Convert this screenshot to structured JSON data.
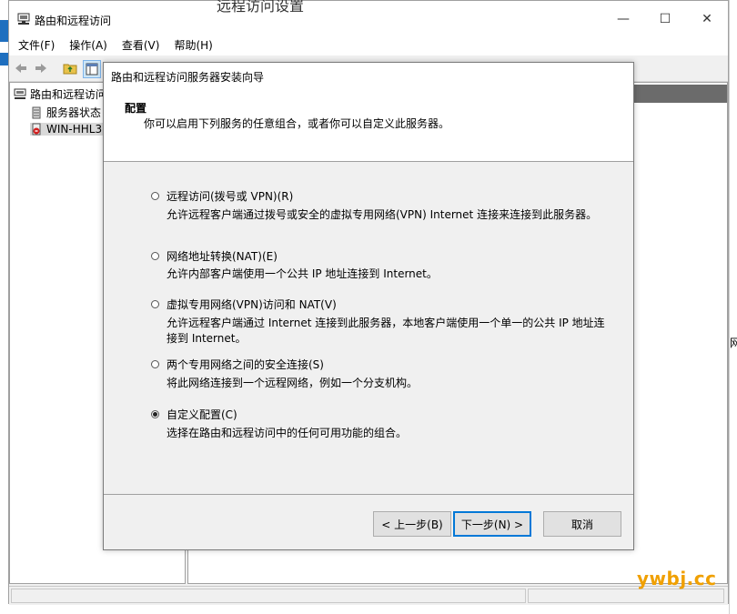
{
  "main_window": {
    "title": "路由和远程访问",
    "controls": {
      "minimize": "—",
      "maximize": "☐",
      "close": "✕"
    },
    "menu": [
      "文件(F)",
      "操作(A)",
      "查看(V)",
      "帮助(H)"
    ],
    "tree": {
      "root": "路由和远程访问",
      "items": [
        "服务器状态",
        "WIN-HHL3"
      ]
    }
  },
  "wizard": {
    "title": "路由和远程访问服务器安装向导",
    "header_title": "配置",
    "header_subtitle": "你可以启用下列服务的任意组合，或者你可以自定义此服务器。",
    "options": [
      {
        "label": "远程访问(拨号或 VPN)(R)",
        "desc": "允许远程客户端通过拨号或安全的虚拟专用网络(VPN) Internet 连接来连接到此服务器。",
        "selected": false
      },
      {
        "label": "网络地址转换(NAT)(E)",
        "desc": "允许内部客户端使用一个公共 IP 地址连接到 Internet。",
        "selected": false
      },
      {
        "label": "虚拟专用网络(VPN)访问和 NAT(V)",
        "desc_line1": "允许远程客户端通过 Internet 连接到此服务器，本地客户端使用一个单一的公共 IP 地址连",
        "desc_line2": "接到 Internet。",
        "selected": false
      },
      {
        "label": "两个专用网络之间的安全连接(S)",
        "desc": "将此网络连接到一个远程网络，例如一个分支机构。",
        "selected": false
      },
      {
        "label": "自定义配置(C)",
        "desc": "选择在路由和远程访问中的任何可用功能的组合。",
        "selected": true
      }
    ],
    "buttons": {
      "back": "< 上一步(B)",
      "next": "下一步(N) >",
      "cancel": "取消"
    }
  },
  "background": {
    "partial_title": "远程访问设置",
    "edge_char": "网"
  },
  "watermark": "ywbj.cc"
}
